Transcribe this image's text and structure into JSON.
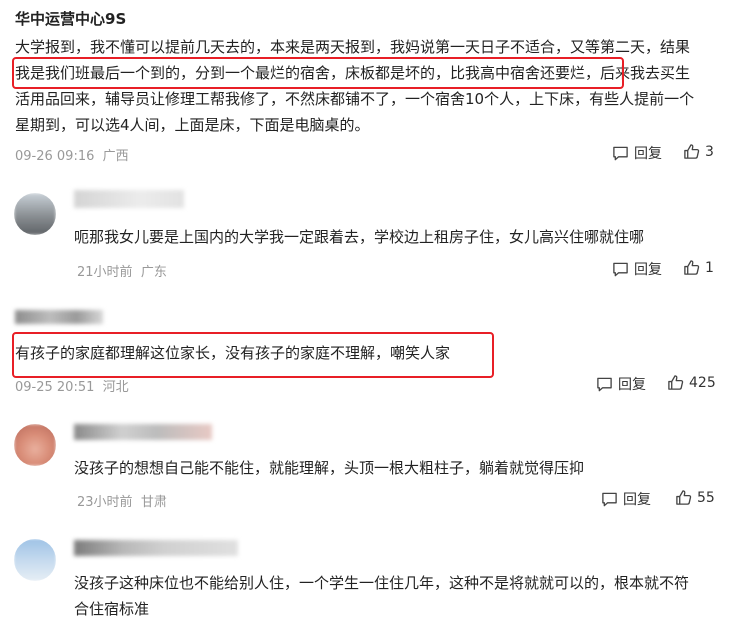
{
  "c1": {
    "username": "华中运营中心9S",
    "lines": [
      "大学报到，我不懂可以提前几天去的，本来是两天报到，我妈说第一天日子不适合，又等第二天，结果",
      "我是我们班最后一个到的，分到一个最烂的宿舍，床板都是坏的，比我高中宿舍还要烂，后来我去买生",
      "活用品回来，辅导员让修理工帮我修了，不然床都铺不了，一个宿舍10个人，上下床，有些人提前一个",
      "星期到，可以选4人间，上面是床，下面是电脑桌的。"
    ],
    "time": "09-26 09:16",
    "location": "广西",
    "reply": "回复",
    "likes": "3"
  },
  "c2": {
    "text": "呃那我女儿要是上国内的大学我一定跟着去，学校边上租房子住，女儿高兴住哪就住哪",
    "time": "21小时前",
    "location": "广东",
    "reply": "回复",
    "likes": "1"
  },
  "c3": {
    "text": "有孩子的家庭都理解这位家长，没有孩子的家庭不理解，嘲笑人家",
    "time": "09-25 20:51",
    "location": "河北",
    "reply": "回复",
    "likes": "425"
  },
  "c4": {
    "text": "没孩子的想想自己能不能住，就能理解，头顶一根大粗柱子，躺着就觉得压抑",
    "time": "23小时前",
    "location": "甘肃",
    "reply": "回复",
    "likes": "55"
  },
  "c5": {
    "lines": [
      "没孩子这种床位也不能给别人住，一个学生一住住几年，这种不是将就就可以的，根本就不符",
      "合住宿标准"
    ]
  },
  "colors": {
    "highlight": "#e81f26",
    "meta": "#999999",
    "text": "#222222"
  },
  "icons": {
    "reply": "comment-bubble-icon",
    "like": "thumbs-up-icon"
  }
}
